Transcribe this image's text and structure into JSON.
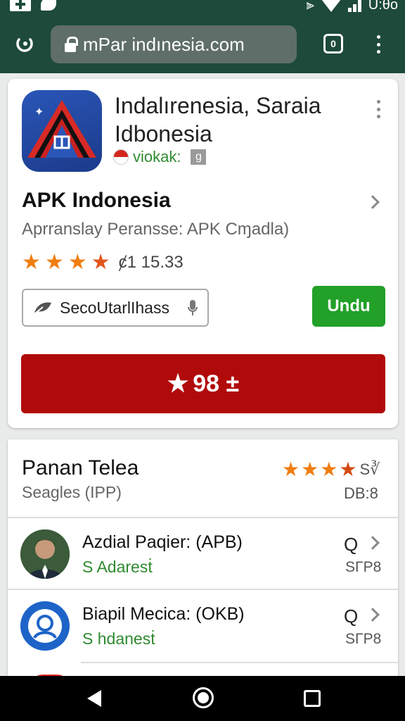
{
  "status_bar": {
    "time": "U:θo"
  },
  "browser": {
    "url": "mPar indınesia.com",
    "tabs_count": "0"
  },
  "app": {
    "title": "Indalırenesia, Saraia Idbonesia",
    "developer": "viokak:",
    "developer_badge": "g",
    "apk_name": "APK Indonesia",
    "description": "Aprranslay Peransse: APK Cɱadla)",
    "rating_stars": 4,
    "rating_text": "ȼ1 15.33",
    "search_placeholder": "SecoUtarlIhass",
    "install_label": "Undu",
    "big_button_label": "98 ±"
  },
  "section": {
    "title": "Panan Telea",
    "subtitle": "Seagles (IPP)",
    "stars": 4,
    "stars_suffix": "S∛",
    "count": "DB:8"
  },
  "list": [
    {
      "name": "Azdial Paqier: (APB)",
      "sub": "S Adaresṫ",
      "q": "Q",
      "size": "SΓP8"
    },
    {
      "name": "Biapil Mecica: (OKB)",
      "sub": "S hdanesṫ",
      "q": "Q",
      "size": "SΓP8"
    }
  ],
  "colors": {
    "brand_bar": "#1d4a3a",
    "install": "#22a028",
    "cta": "#b10a0a",
    "star": "#f07d10"
  }
}
